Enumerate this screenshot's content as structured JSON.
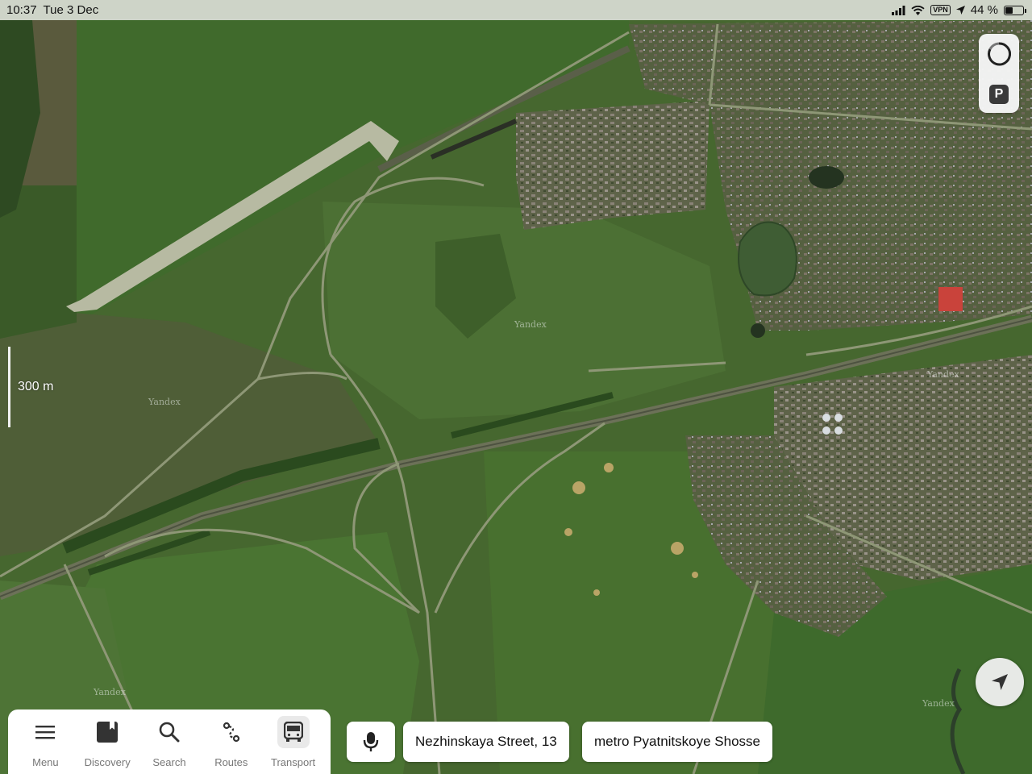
{
  "status": {
    "time": "10:37",
    "date": "Tue 3 Dec",
    "vpn": "VPN",
    "battery": "44 %",
    "battery_level": 0.44
  },
  "map": {
    "scale_label": "300 m",
    "watermark": "Yandex",
    "layers": {
      "parking_label": "P"
    }
  },
  "bottom_nav": {
    "items": [
      {
        "label": "Menu",
        "icon": "menu-icon"
      },
      {
        "label": "Discovery",
        "icon": "bookmark-icon"
      },
      {
        "label": "Search",
        "icon": "search-icon"
      },
      {
        "label": "Routes",
        "icon": "routes-icon"
      },
      {
        "label": "Transport",
        "icon": "bus-icon",
        "active": true
      }
    ]
  },
  "quick_destinations": [
    {
      "label": "Nezhinskaya Street, 13"
    },
    {
      "label": "metro Pyatnitskoye Shosse"
    }
  ],
  "colors": {
    "field_green": "#4a6b34",
    "dark_green": "#2f4a22",
    "road": "#8f9b78",
    "runway": "#b9bca4",
    "town": "#6f6a5a",
    "water": "#3e5733"
  }
}
